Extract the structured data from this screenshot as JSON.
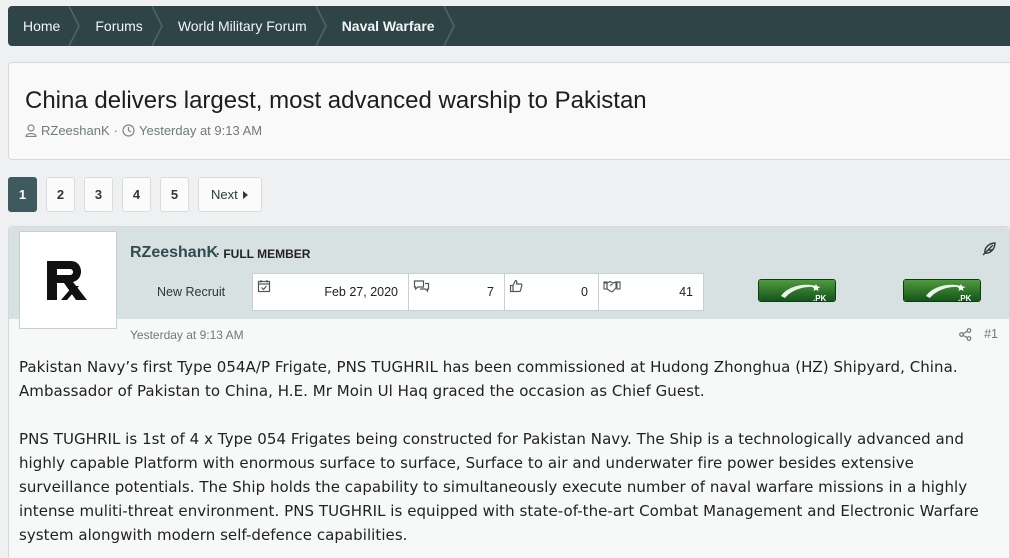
{
  "breadcrumbs": [
    {
      "label": "Home"
    },
    {
      "label": "Forums"
    },
    {
      "label": "World Military Forum"
    },
    {
      "label": "Naval Warfare"
    }
  ],
  "thread": {
    "title": "China delivers largest, most advanced warship to Pakistan",
    "author": "RZeeshanK",
    "separator": "·",
    "time": "Yesterday at 9:13 AM"
  },
  "pagination": {
    "pages": [
      "1",
      "2",
      "3",
      "4",
      "5"
    ],
    "current": "1",
    "next_label": "Next"
  },
  "post": {
    "username": "RZeeshanK",
    "user_title": "· FULL MEMBER",
    "rank": "New Recruit",
    "stats": [
      {
        "icon": "calendar-icon",
        "value": "Feb 27, 2020"
      },
      {
        "icon": "message-bubbles-icon",
        "value": "7"
      },
      {
        "icon": "thumbs-up-icon",
        "value": "0"
      },
      {
        "icon": "handshake-icon",
        "value": "41"
      }
    ],
    "flag_label": ".PK",
    "date": "Yesterday at 9:13 AM",
    "post_number": "#1",
    "paragraphs": [
      "Pakistan Navy’s first Type 054A/P Frigate, PNS TUGHRIL has been commissioned at Hudong Zhonghua (HZ) Shipyard, China. Ambassador of Pakistan to China, H.E. Mr Moin Ul Haq graced the occasion as Chief Guest.",
      "PNS TUGHRIL is 1st of 4 x Type 054 Frigates being constructed for Pakistan Navy. The Ship is a technologically advanced and highly capable Platform with enormous surface to surface, Surface to air and underwater fire power besides extensive surveillance potentials. The Ship holds the capability to simultaneously execute number of naval warfare missions in a highly intense muliti-threat environment. PNS TUGHRIL is equipped with state-of-the-art Combat Management and Electronic Warfare system alongwith modern self-defence capabilities."
    ]
  },
  "colors": {
    "nav_bg": "#2f4447",
    "accent": "#3e5a5e",
    "post_header_bg": "#d8e1e2",
    "username": "#2f4d50",
    "flag_green": "#1b6b22"
  }
}
